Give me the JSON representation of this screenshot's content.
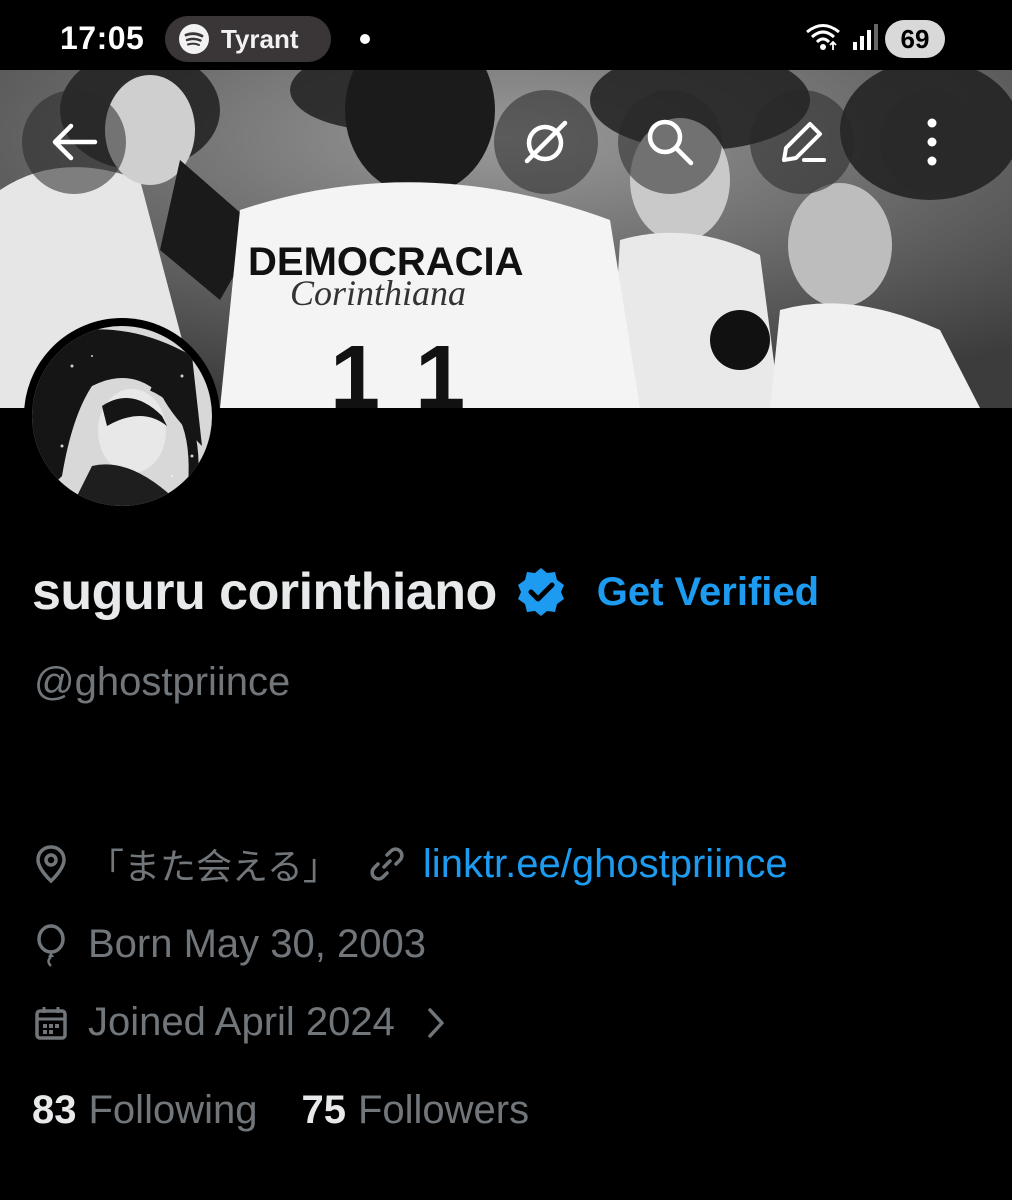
{
  "status_bar": {
    "time": "17:05",
    "media_app_icon": "spotify-icon",
    "media_title": "Tyrant",
    "battery": "69"
  },
  "banner": {
    "shirt_text_line1": "DEMOCRACIA",
    "shirt_text_line2": "Corinthiana",
    "shirt_number": "11"
  },
  "header_buttons": {
    "back": "arrow-left-icon",
    "grok": "grok-icon",
    "search": "search-icon",
    "edit": "pencil-icon",
    "more": "more-vertical-icon"
  },
  "profile": {
    "display_name": "suguru corinthiano",
    "get_verified_label": "Get Verified",
    "handle": "@ghostpriince",
    "location": "「また会える」",
    "website": "linktr.ee/ghostpriince",
    "birthday": "Born May 30, 2003",
    "joined": "Joined April 2024",
    "following_count": "83",
    "following_label": "Following",
    "followers_count": "75",
    "followers_label": "Followers"
  },
  "colors": {
    "accent": "#1d9bf0",
    "secondary_text": "#71767b",
    "primary_text": "#e7e9ea",
    "background": "#000000"
  }
}
